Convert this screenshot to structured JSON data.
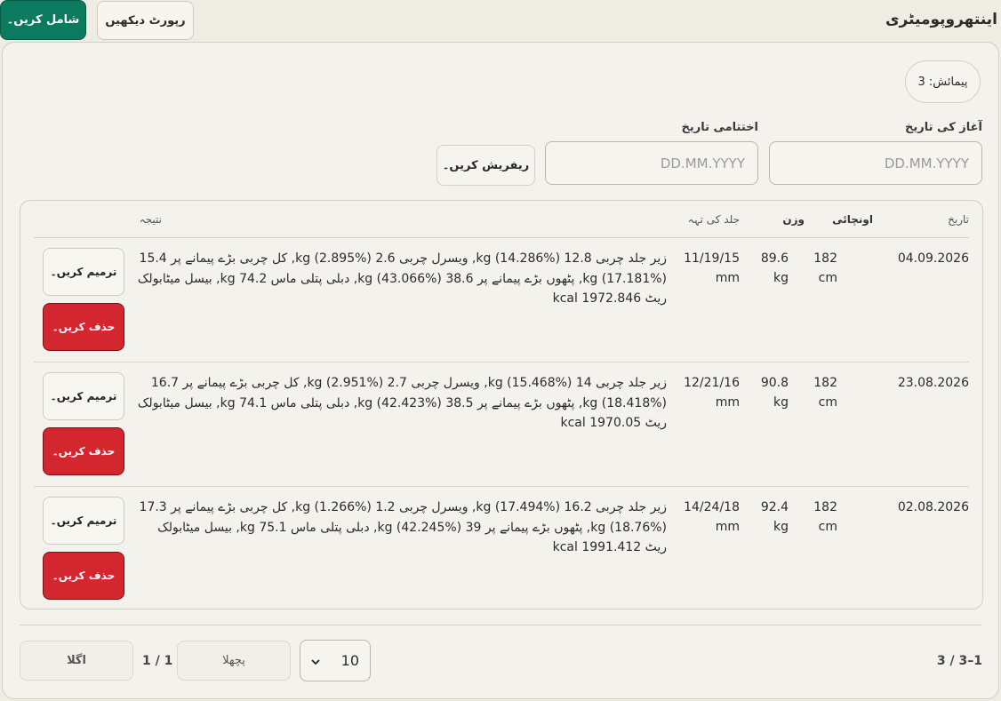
{
  "header": {
    "title": "اینتھروپومیٹری",
    "add_label": "شامل کریں۔",
    "report_label": "رپورٹ دیکھیں"
  },
  "summary": {
    "count_text": "پیمائش: 3"
  },
  "filters": {
    "start_label": "آغاز کی تاریخ",
    "end_label": "اختتامی تاریخ",
    "start_placeholder": "DD.MM.YYYY",
    "end_placeholder": "DD.MM.YYYY",
    "refresh_label": "ریفریش کریں۔"
  },
  "table": {
    "headers": {
      "date": "تاریخ",
      "height": "اونچائی",
      "weight": "وزن",
      "skinfold": "جلد کی تہہ",
      "result": "نتیجہ"
    },
    "rows": [
      {
        "date": "04.09.2026",
        "height_value": "182",
        "height_unit": "cm",
        "weight_value": "89.6",
        "weight_unit": "kg",
        "skinfold_value": "11/19/15",
        "skinfold_unit": "mm",
        "result": "زیر جلد چربی 12.8 kg (14.286%), ویسرل چربی 2.6 kg (2.895%), کل چربی بڑے پیمانے پر 15.4 kg (17.181%), پٹھوں بڑے پیمانے پر 38.6 kg (43.066%), دبلی پتلی ماس 74.2 kg, بیسل میٹابولک ریٹ 1972.846 kcal",
        "edit_label": "ترمیم کریں۔",
        "delete_label": "حذف کریں۔"
      },
      {
        "date": "23.08.2026",
        "height_value": "182",
        "height_unit": "cm",
        "weight_value": "90.8",
        "weight_unit": "kg",
        "skinfold_value": "12/21/16",
        "skinfold_unit": "mm",
        "result": "زیر جلد چربی 14 kg (15.468%), ویسرل چربی 2.7 kg (2.951%), کل چربی بڑے پیمانے پر 16.7 kg (18.418%), پٹھوں بڑے پیمانے پر 38.5 kg (42.423%), دبلی پتلی ماس 74.1 kg, بیسل میٹابولک ریٹ 1970.05 kcal",
        "edit_label": "ترمیم کریں۔",
        "delete_label": "حذف کریں۔"
      },
      {
        "date": "02.08.2026",
        "height_value": "182",
        "height_unit": "cm",
        "weight_value": "92.4",
        "weight_unit": "kg",
        "skinfold_value": "14/24/18",
        "skinfold_unit": "mm",
        "result": "زیر جلد چربی 16.2 kg (17.494%), ویسرل چربی 1.2 kg (1.266%), کل چربی بڑے پیمانے پر 17.3 kg (18.76%), پٹھوں بڑے پیمانے پر 39 kg (42.245%), دبلی پتلی ماس 75.1 kg, بیسل میٹابولک ریٹ 1991.412 kcal",
        "edit_label": "ترمیم کریں۔",
        "delete_label": "حذف کریں۔"
      }
    ]
  },
  "pagination": {
    "range_text": "1–3 / 3",
    "page_size": "10",
    "prev_label": "پچھلا",
    "page_info": "1 / 1",
    "next_label": "اگلا"
  },
  "colors": {
    "primary": "#0c7a5e",
    "danger": "#d3262f",
    "background": "#efece4"
  }
}
